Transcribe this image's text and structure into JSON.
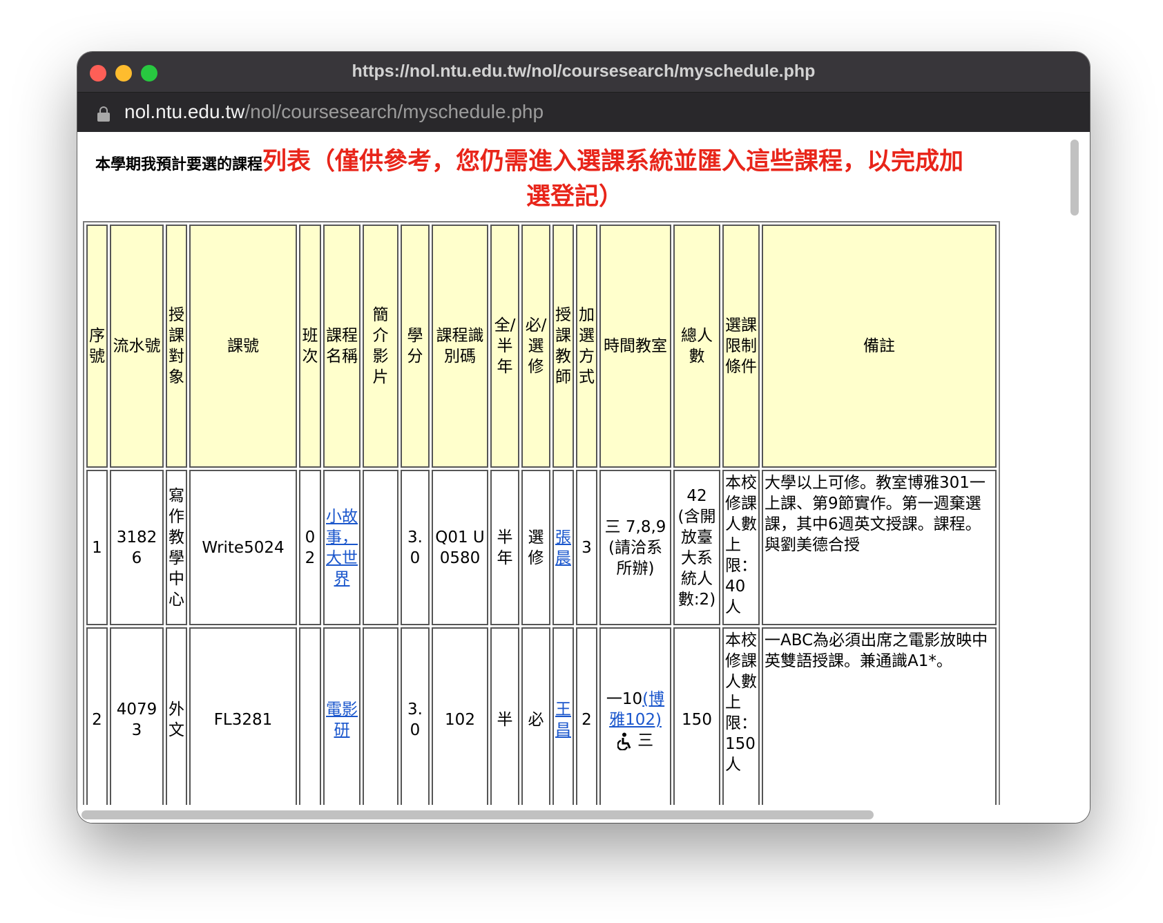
{
  "window": {
    "title": "https://nol.ntu.edu.tw/nol/coursesearch/myschedule.php",
    "url_host": "nol.ntu.edu.tw",
    "url_path": "/nol/coursesearch/myschedule.php"
  },
  "heading": {
    "small": "本學期我預計要選的課程",
    "line1": "列表（僅供參考，您仍需進入選課系統並匯入這些課程，以完成加",
    "line2": "選登記）"
  },
  "table": {
    "headers": [
      "序號",
      "流水號",
      "授課對象",
      "課號",
      "班次",
      "課程名稱",
      "簡介影片",
      "學分",
      "課程識別碼",
      "全/半年",
      "必/選修",
      "授課教師",
      "加選方式",
      "時間教室",
      "總人數",
      "選課限制條件",
      "備註"
    ],
    "rows": [
      {
        "seq": "1",
        "serial": "31826",
        "target": "寫作教學中心",
        "course_no": "Write5024",
        "class": "02",
        "name": "小故事，大世界",
        "video": "",
        "credits": "3.0",
        "course_id": "Q01 U0580",
        "full_half": "半年",
        "required": "選修",
        "teacher": "張晨",
        "add_method": "3",
        "time_room": "三 7,8,9(請洽系所辦)",
        "total": "42(含開放臺大系統人數:2)",
        "limit": "本校修課人數上限：40人",
        "remark": "大學以上可修。教室博雅301一上課、第9節實作。第一週棄選課，其中6週英文授課。課程。與劉美德合授"
      },
      {
        "seq": "2",
        "serial": "40793",
        "target": "外文",
        "course_no": "FL3281",
        "class": "",
        "name": "電影研",
        "video": "",
        "credits": "3.0",
        "course_id": "102",
        "full_half": "半",
        "required": "必",
        "teacher": "王昌",
        "add_method": "2",
        "time_prefix": "一10",
        "room_link": "(博雅102)",
        "time_suffix": "三",
        "total": "150",
        "limit": "本校修課人數上限：150人",
        "remark": "一ABC為必須出席之電影放映中英雙語授課。兼通識A1*。"
      }
    ]
  },
  "icons": {
    "lock": "lock-icon",
    "accessible": "wheelchair-icon"
  },
  "colors": {
    "header_bg": "#ffffcc",
    "heading_red": "#e8251a",
    "link": "#1a56cc",
    "titlebar": "#38363a"
  }
}
